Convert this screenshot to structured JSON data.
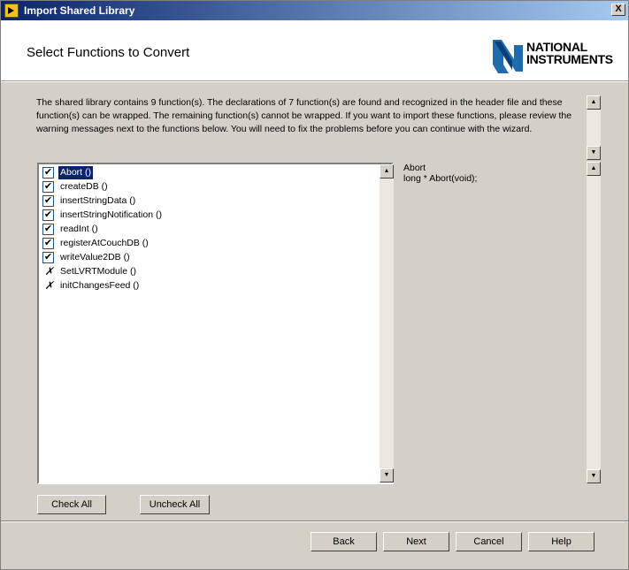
{
  "window": {
    "title": "Import Shared Library",
    "close_label": "X"
  },
  "header": {
    "heading": "Select Functions to Convert",
    "logo": {
      "line1": "NATIONAL",
      "line2": "INSTRUMENTS",
      "icon": "ni-eagle-logo"
    }
  },
  "description": "The shared library contains 9 function(s). The declarations of 7 function(s) are found and recognized in the header file and these function(s) can be wrapped. The remaining function(s) cannot be wrapped. If you want to import these functions, please review the warning messages next to the functions below. You will need to fix the problems before you can continue with the wizard.",
  "functions": [
    {
      "label": "Abort ()",
      "state": "checked",
      "selected": true
    },
    {
      "label": "createDB ()",
      "state": "checked"
    },
    {
      "label": "insertStringData ()",
      "state": "checked"
    },
    {
      "label": "insertStringNotification ()",
      "state": "checked"
    },
    {
      "label": "readInt ()",
      "state": "checked"
    },
    {
      "label": "registerAtCouchDB ()",
      "state": "checked"
    },
    {
      "label": "writeValue2DB ()",
      "state": "checked"
    },
    {
      "label": "SetLVRTModule ()",
      "state": "error"
    },
    {
      "label": "initChangesFeed ()",
      "state": "error"
    }
  ],
  "detail": {
    "name": "Abort",
    "signature": "long * Abort(void);"
  },
  "buttons": {
    "check_all": "Check All",
    "uncheck_all": "Uncheck All",
    "back": "Back",
    "next": "Next",
    "cancel": "Cancel",
    "help": "Help"
  },
  "glyphs": {
    "check": "✔",
    "error": "✗",
    "up": "▲",
    "down": "▼"
  }
}
